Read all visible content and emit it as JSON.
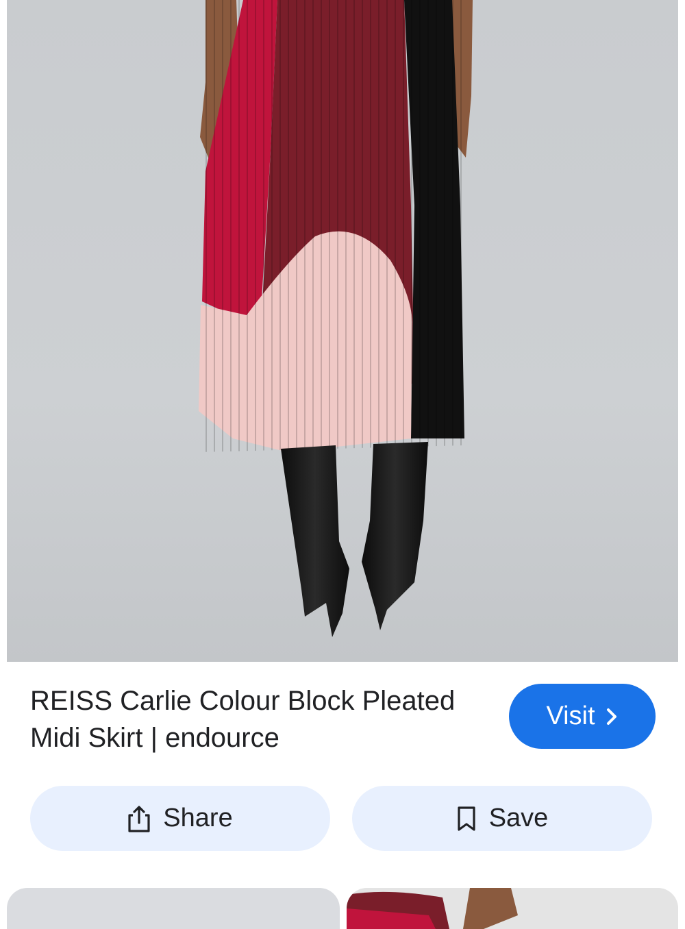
{
  "product": {
    "title_line1": "REISS Carlie Colour Block Pleated",
    "title_line2": "Midi Skirt | endource"
  },
  "actions": {
    "visit_label": "Visit",
    "share_label": "Share",
    "save_label": "Save"
  },
  "icons": {
    "visit": "chevron-right-icon",
    "share": "share-icon",
    "save": "bookmark-icon"
  },
  "colors": {
    "accent": "#1a73e8",
    "button_bg": "#e8f0fe",
    "text": "#202124"
  }
}
